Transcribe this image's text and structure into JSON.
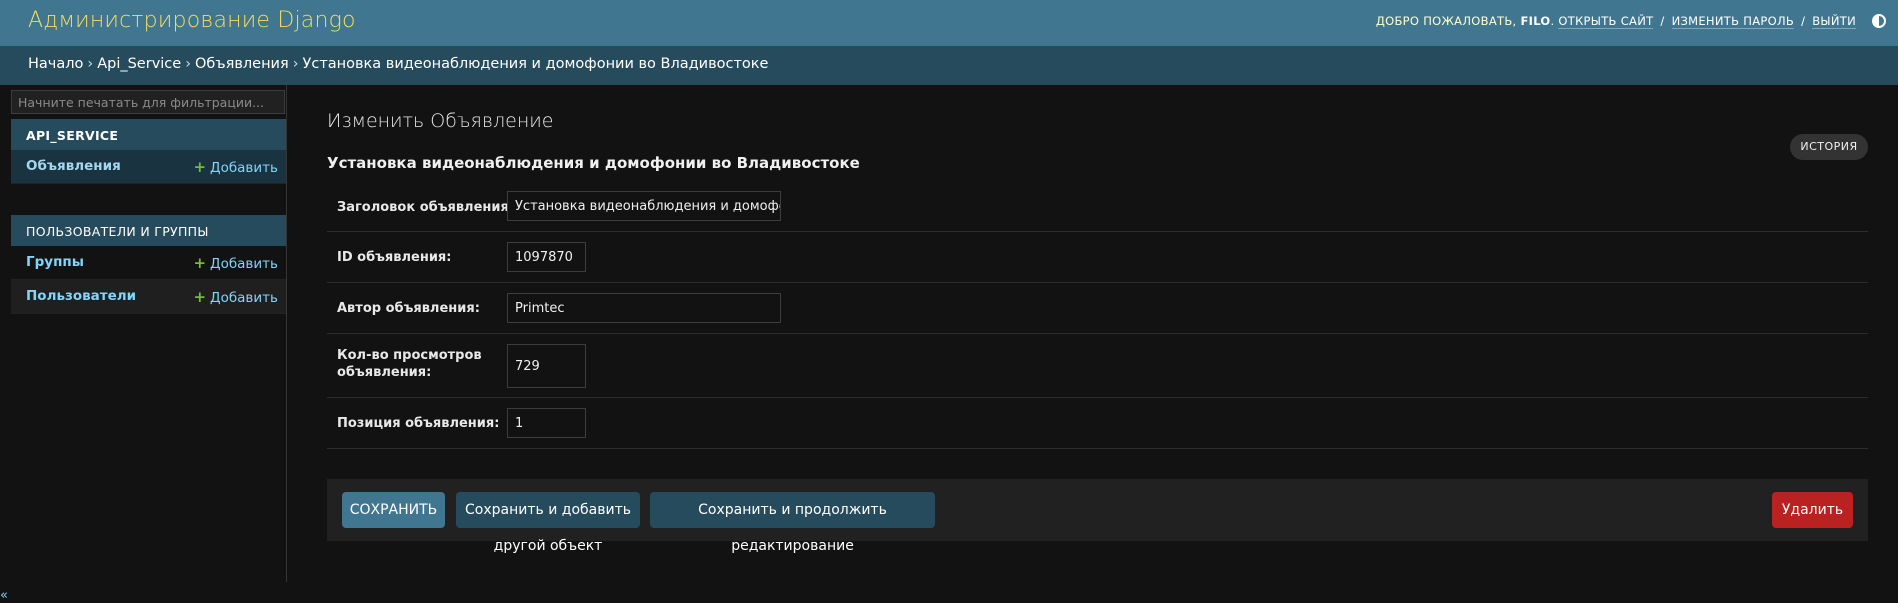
{
  "header": {
    "site_title": "Администрирование Django",
    "welcome": "ДОБРО ПОЖАЛОВАТЬ,",
    "username": "FILO",
    "view_site": "ОТКРЫТЬ САЙТ",
    "change_password": "ИЗМЕНИТЬ ПАРОЛЬ",
    "logout": "ВЫЙТИ",
    "separator": "/"
  },
  "breadcrumbs": {
    "home": "Начало",
    "app": "Api_Service",
    "model": "Объявления",
    "current": "Установка видеонаблюдения и домофонии во Владивостоке",
    "separator": "›"
  },
  "sidebar": {
    "filter_placeholder": "Начните печатать для фильтрации...",
    "modules": [
      {
        "caption": "API_SERVICE",
        "models": [
          {
            "name": "Объявления",
            "add": "Добавить"
          }
        ]
      },
      {
        "caption": "ПОЛЬЗОВАТЕЛИ И ГРУППЫ",
        "models": [
          {
            "name": "Группы",
            "add": "Добавить"
          },
          {
            "name": "Пользователи",
            "add": "Добавить"
          }
        ]
      }
    ],
    "collapse_label": "«"
  },
  "content": {
    "title": "Изменить Объявление",
    "object_title": "Установка видеонаблюдения и домофонии во Владивостоке",
    "history_button": "ИСТОРИЯ",
    "fields": [
      {
        "label": "Заголовок объявления:",
        "value": "Установка видеонаблюдения и домофонии"
      },
      {
        "label": "ID объявления:",
        "value": "1097870"
      },
      {
        "label": "Автор объявления:",
        "value": "Primtec"
      },
      {
        "label": "Кол-во просмотров объявления:",
        "value": "729"
      },
      {
        "label": "Позиция объявления:",
        "value": "1"
      }
    ]
  },
  "submit_row": {
    "save": "СОХРАНИТЬ",
    "save_add_another": "Сохранить и добавить другой объект",
    "save_continue": "Сохранить и продолжить редактирование",
    "delete": "Удалить"
  },
  "colors": {
    "header_bg": "#417690",
    "breadcrumb_bg": "#264b5d",
    "site_title": "#f5dd5d",
    "link": "#81d4fa",
    "add_plus": "#70bf2b",
    "delete": "#ba2121"
  },
  "icons": {
    "theme_toggle": "half-circle-icon",
    "add": "plus-icon"
  }
}
